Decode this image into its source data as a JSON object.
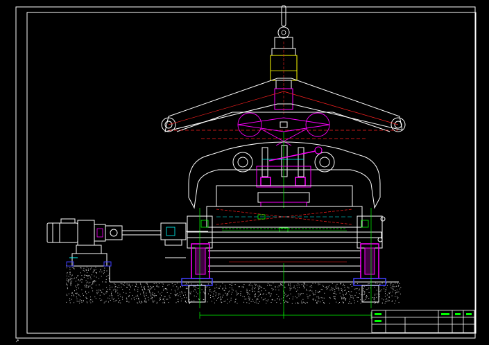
{
  "drawing": {
    "title_block_text": "",
    "dimensions": [
      "",
      "",
      ""
    ],
    "colors": {
      "background": "#000000",
      "frame": "#ffffff",
      "structure": "#ffffff",
      "hidden": "#ff2020",
      "mechanism": "#ff00ff",
      "hook": "#ffff00",
      "section": "#00ffff",
      "dimension": "#00ff00",
      "bracket": "#4040ff"
    },
    "ucs_icon": "ucs-axis-icon"
  }
}
